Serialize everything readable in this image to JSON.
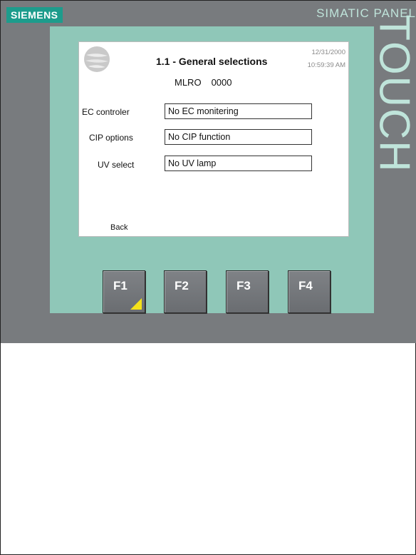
{
  "device": {
    "brand": "SIEMENS",
    "product": "SIMATIC PANEL",
    "vertical_label": "TOUCH",
    "colors": {
      "brand_badge": "#1d9c8c",
      "bezel": "#8fc7b8",
      "housing": "#787b7e",
      "softkey_marker": "#f4e11a"
    }
  },
  "screen": {
    "title": "1.1 - General selections",
    "date": "12/31/2000",
    "time": "10:59:39 AM",
    "mlro_label": "MLRO",
    "mlro_value": "0000",
    "rows": [
      {
        "label": "EC controler",
        "value": "No EC monitering"
      },
      {
        "label": "CIP options",
        "value": "No CIP function"
      },
      {
        "label": "UV select",
        "value": "No UV lamp"
      }
    ],
    "back_label": "Back"
  },
  "function_keys": [
    {
      "label": "F1",
      "icon": "yellow-corner-triangle-icon"
    },
    {
      "label": "F2"
    },
    {
      "label": "F3"
    },
    {
      "label": "F4"
    }
  ]
}
